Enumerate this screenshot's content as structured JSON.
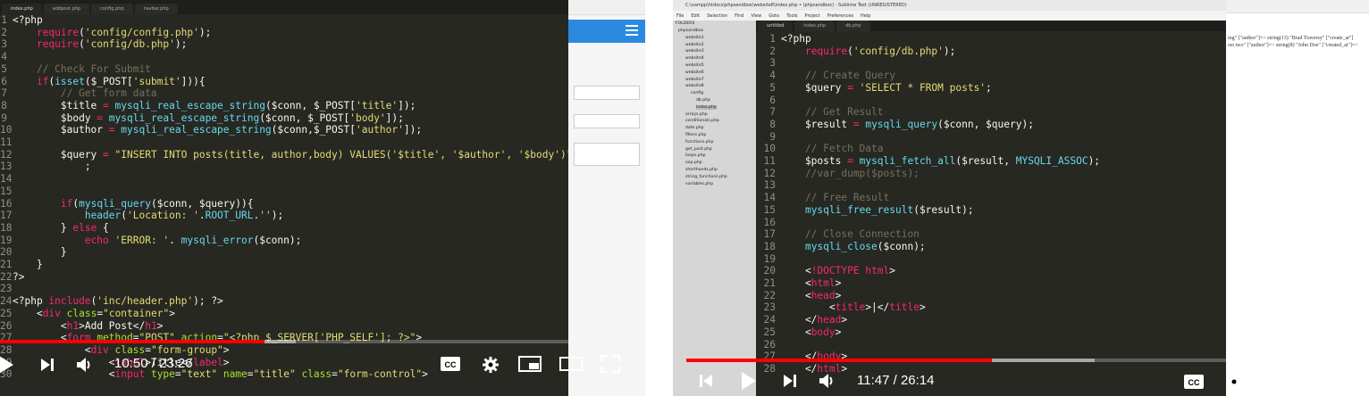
{
  "left_player": {
    "tabs": [
      "index.php",
      "addpost.php",
      "config.php",
      "navbar.php"
    ],
    "time_current": "10:50",
    "time_separator": " / ",
    "time_total": "23:26",
    "progress_fraction": 0.466,
    "buffered_fraction": 0.52,
    "line_numbers": [
      "1",
      "2",
      "3",
      "4",
      "5",
      "6",
      "7",
      "8",
      "9",
      "10",
      "11",
      "12",
      "13",
      "14",
      "15",
      "16",
      "17",
      "18",
      "19",
      "20",
      "21",
      "22",
      "23",
      "24",
      "25",
      "26",
      "27",
      "28",
      "29",
      "30"
    ],
    "code": [
      [
        {
          "c": "v",
          "t": "<?php"
        }
      ],
      [
        {
          "c": "v",
          "t": "    "
        },
        {
          "c": "k",
          "t": "require"
        },
        {
          "c": "v",
          "t": "("
        },
        {
          "c": "s",
          "t": "'config/config.php'"
        },
        {
          "c": "v",
          "t": ");"
        }
      ],
      [
        {
          "c": "v",
          "t": "    "
        },
        {
          "c": "k",
          "t": "require"
        },
        {
          "c": "v",
          "t": "("
        },
        {
          "c": "s",
          "t": "'config/db.php'"
        },
        {
          "c": "v",
          "t": ");"
        }
      ],
      [],
      [
        {
          "c": "c",
          "t": "    // Check For Submit"
        }
      ],
      [
        {
          "c": "v",
          "t": "    "
        },
        {
          "c": "k",
          "t": "if"
        },
        {
          "c": "v",
          "t": "("
        },
        {
          "c": "f",
          "t": "isset"
        },
        {
          "c": "v",
          "t": "($_POST["
        },
        {
          "c": "s",
          "t": "'submit'"
        },
        {
          "c": "v",
          "t": "])){"
        }
      ],
      [
        {
          "c": "c",
          "t": "        // Get form data"
        }
      ],
      [
        {
          "c": "v",
          "t": "        $title "
        },
        {
          "c": "k",
          "t": "="
        },
        {
          "c": "v",
          "t": " "
        },
        {
          "c": "f",
          "t": "mysqli_real_escape_string"
        },
        {
          "c": "v",
          "t": "($conn, $_POST["
        },
        {
          "c": "s",
          "t": "'title'"
        },
        {
          "c": "v",
          "t": "]);"
        }
      ],
      [
        {
          "c": "v",
          "t": "        $body "
        },
        {
          "c": "k",
          "t": "="
        },
        {
          "c": "v",
          "t": " "
        },
        {
          "c": "f",
          "t": "mysqli_real_escape_string"
        },
        {
          "c": "v",
          "t": "($conn, $_POST["
        },
        {
          "c": "s",
          "t": "'body'"
        },
        {
          "c": "v",
          "t": "]);"
        }
      ],
      [
        {
          "c": "v",
          "t": "        $author "
        },
        {
          "c": "k",
          "t": "="
        },
        {
          "c": "v",
          "t": " "
        },
        {
          "c": "f",
          "t": "mysqli_real_escape_string"
        },
        {
          "c": "v",
          "t": "($conn,$_POST["
        },
        {
          "c": "s",
          "t": "'author'"
        },
        {
          "c": "v",
          "t": "]);"
        }
      ],
      [],
      [
        {
          "c": "v",
          "t": "        $query "
        },
        {
          "c": "k",
          "t": "="
        },
        {
          "c": "v",
          "t": " "
        },
        {
          "c": "s",
          "t": "\"INSERT INTO posts(title, author,body) VALUES('$title', '$author', '$body')\""
        }
      ],
      [
        {
          "c": "v",
          "t": "            ;"
        }
      ],
      [],
      [],
      [
        {
          "c": "v",
          "t": "        "
        },
        {
          "c": "k",
          "t": "if"
        },
        {
          "c": "v",
          "t": "("
        },
        {
          "c": "f",
          "t": "mysqli_query"
        },
        {
          "c": "v",
          "t": "($conn, $query)){"
        }
      ],
      [
        {
          "c": "v",
          "t": "            "
        },
        {
          "c": "f",
          "t": "header"
        },
        {
          "c": "v",
          "t": "("
        },
        {
          "c": "s",
          "t": "'Location: '"
        },
        {
          "c": "v",
          "t": "."
        },
        {
          "c": "f",
          "t": "ROOT_URL"
        },
        {
          "c": "v",
          "t": "."
        },
        {
          "c": "s",
          "t": "''"
        },
        {
          "c": "v",
          "t": ");"
        }
      ],
      [
        {
          "c": "v",
          "t": "        } "
        },
        {
          "c": "k",
          "t": "else"
        },
        {
          "c": "v",
          "t": " {"
        }
      ],
      [
        {
          "c": "v",
          "t": "            "
        },
        {
          "c": "k",
          "t": "echo"
        },
        {
          "c": "v",
          "t": " "
        },
        {
          "c": "s",
          "t": "'ERROR: '"
        },
        {
          "c": "v",
          "t": ". "
        },
        {
          "c": "f",
          "t": "mysqli_error"
        },
        {
          "c": "v",
          "t": "($conn);"
        }
      ],
      [
        {
          "c": "v",
          "t": "        }"
        }
      ],
      [
        {
          "c": "v",
          "t": "    }"
        }
      ],
      [
        {
          "c": "v",
          "t": "?>"
        }
      ],
      [],
      [
        {
          "c": "v",
          "t": "<?php "
        },
        {
          "c": "k",
          "t": "include"
        },
        {
          "c": "v",
          "t": "("
        },
        {
          "c": "s",
          "t": "'inc/header.php'"
        },
        {
          "c": "v",
          "t": "); ?>"
        }
      ],
      [
        {
          "c": "v",
          "t": "    <"
        },
        {
          "c": "t",
          "t": "div"
        },
        {
          "c": "v",
          "t": " "
        },
        {
          "c": "a",
          "t": "class"
        },
        {
          "c": "v",
          "t": "="
        },
        {
          "c": "s",
          "t": "\"container\""
        },
        {
          "c": "v",
          "t": ">"
        }
      ],
      [
        {
          "c": "v",
          "t": "        <"
        },
        {
          "c": "t",
          "t": "h1"
        },
        {
          "c": "v",
          "t": ">Add Post</"
        },
        {
          "c": "t",
          "t": "h1"
        },
        {
          "c": "v",
          "t": ">"
        }
      ],
      [
        {
          "c": "v",
          "t": "        <"
        },
        {
          "c": "t",
          "t": "form"
        },
        {
          "c": "v",
          "t": " "
        },
        {
          "c": "a",
          "t": "method"
        },
        {
          "c": "v",
          "t": "="
        },
        {
          "c": "s",
          "t": "\"POST\""
        },
        {
          "c": "v",
          "t": " "
        },
        {
          "c": "a",
          "t": "action"
        },
        {
          "c": "v",
          "t": "="
        },
        {
          "c": "s",
          "t": "\"<?php $_SERVER['PHP_SELF']; ?>\""
        },
        {
          "c": "v",
          "t": ">"
        }
      ],
      [
        {
          "c": "v",
          "t": "            <"
        },
        {
          "c": "t",
          "t": "div"
        },
        {
          "c": "v",
          "t": " "
        },
        {
          "c": "a",
          "t": "class"
        },
        {
          "c": "v",
          "t": "="
        },
        {
          "c": "s",
          "t": "\"form-group\""
        },
        {
          "c": "v",
          "t": ">"
        }
      ],
      [
        {
          "c": "v",
          "t": "                <"
        },
        {
          "c": "t",
          "t": "label"
        },
        {
          "c": "v",
          "t": ">Title</"
        },
        {
          "c": "t",
          "t": "label"
        },
        {
          "c": "v",
          "t": ">"
        }
      ],
      [
        {
          "c": "v",
          "t": "                <"
        },
        {
          "c": "t",
          "t": "input"
        },
        {
          "c": "v",
          "t": " "
        },
        {
          "c": "a",
          "t": "type"
        },
        {
          "c": "v",
          "t": "="
        },
        {
          "c": "s",
          "t": "\"text\""
        },
        {
          "c": "v",
          "t": " "
        },
        {
          "c": "a",
          "t": "name"
        },
        {
          "c": "v",
          "t": "="
        },
        {
          "c": "s",
          "t": "\"title\""
        },
        {
          "c": "v",
          "t": " "
        },
        {
          "c": "a",
          "t": "class"
        },
        {
          "c": "v",
          "t": "="
        },
        {
          "c": "s",
          "t": "\"form-control\""
        },
        {
          "c": "v",
          "t": ">"
        }
      ]
    ]
  },
  "right_player": {
    "window_title": "C:\\xampp\\htdocs\\phpsandbox\\website8\\index.php • (phpsandbox) - Sublime Text (UNREGISTERED)",
    "menu": [
      "File",
      "Edit",
      "Selection",
      "Find",
      "View",
      "Goto",
      "Tools",
      "Project",
      "Preferences",
      "Help"
    ],
    "sidebar_label": "FOLDERS",
    "sidebar": [
      "phpsandbox",
      "website1",
      "website2",
      "website3",
      "website4",
      "website5",
      "website6",
      "website7",
      "website8",
      "config",
      "db.php",
      "index.php",
      "arrays.php",
      "conditionals.php",
      "date.php",
      "filters.php",
      "functions.php",
      "get_post.php",
      "loops.php",
      "oop.php",
      "shorthands.php",
      "string_functions.php",
      "variables.php"
    ],
    "tabs": [
      "untitled",
      "index.php",
      "db.php"
    ],
    "time_current": "11:47",
    "time_separator": " / ",
    "time_total": "26:14",
    "progress_fraction": 0.45,
    "buffered_fraction": 0.6,
    "web_text": [
      "ing\" [\"author\"]=> string(13) \"Brad Traversy\" [\"create_at\"]",
      "ost two\" [\"author\"]=> string(8) \"John Doe\" [\"created_at\"]=>"
    ],
    "line_numbers": [
      "1",
      "2",
      "3",
      "4",
      "5",
      "6",
      "7",
      "8",
      "9",
      "10",
      "11",
      "12",
      "13",
      "14",
      "15",
      "16",
      "17",
      "18",
      "19",
      "20",
      "21",
      "22",
      "23",
      "24",
      "25",
      "26",
      "27",
      "28"
    ],
    "code": [
      [
        {
          "c": "v",
          "t": "<?php"
        }
      ],
      [
        {
          "c": "v",
          "t": "    "
        },
        {
          "c": "k",
          "t": "require"
        },
        {
          "c": "v",
          "t": "("
        },
        {
          "c": "s",
          "t": "'config/db.php'"
        },
        {
          "c": "v",
          "t": ");"
        }
      ],
      [],
      [
        {
          "c": "c",
          "t": "    // Create Query"
        }
      ],
      [
        {
          "c": "v",
          "t": "    $query "
        },
        {
          "c": "k",
          "t": "="
        },
        {
          "c": "v",
          "t": " "
        },
        {
          "c": "s",
          "t": "'SELECT * FROM posts'"
        },
        {
          "c": "v",
          "t": ";"
        }
      ],
      [],
      [
        {
          "c": "c",
          "t": "    // Get Result"
        }
      ],
      [
        {
          "c": "v",
          "t": "    $result "
        },
        {
          "c": "k",
          "t": "="
        },
        {
          "c": "v",
          "t": " "
        },
        {
          "c": "f",
          "t": "mysqli_query"
        },
        {
          "c": "v",
          "t": "($conn, $query);"
        }
      ],
      [],
      [
        {
          "c": "c",
          "t": "    // Fetch Data"
        }
      ],
      [
        {
          "c": "v",
          "t": "    $posts "
        },
        {
          "c": "k",
          "t": "="
        },
        {
          "c": "v",
          "t": " "
        },
        {
          "c": "f",
          "t": "mysqli_fetch_all"
        },
        {
          "c": "v",
          "t": "($result, "
        },
        {
          "c": "f",
          "t": "MYSQLI_ASSOC"
        },
        {
          "c": "v",
          "t": ");"
        }
      ],
      [
        {
          "c": "c",
          "t": "    //var_dump($posts);"
        }
      ],
      [],
      [
        {
          "c": "c",
          "t": "    // Free Result"
        }
      ],
      [
        {
          "c": "v",
          "t": "    "
        },
        {
          "c": "f",
          "t": "mysqli_free_result"
        },
        {
          "c": "v",
          "t": "($result);"
        }
      ],
      [],
      [
        {
          "c": "c",
          "t": "    // Close Connection"
        }
      ],
      [
        {
          "c": "v",
          "t": "    "
        },
        {
          "c": "f",
          "t": "mysqli_close"
        },
        {
          "c": "v",
          "t": "($conn);"
        }
      ],
      [],
      [
        {
          "c": "v",
          "t": "    <"
        },
        {
          "c": "k",
          "t": "!DOCTYPE"
        },
        {
          "c": "v",
          "t": " "
        },
        {
          "c": "t",
          "t": "html"
        },
        {
          "c": "v",
          "t": ">"
        }
      ],
      [
        {
          "c": "v",
          "t": "    <"
        },
        {
          "c": "t",
          "t": "html"
        },
        {
          "c": "v",
          "t": ">"
        }
      ],
      [
        {
          "c": "v",
          "t": "    <"
        },
        {
          "c": "t",
          "t": "head"
        },
        {
          "c": "v",
          "t": ">"
        }
      ],
      [
        {
          "c": "v",
          "t": "        <"
        },
        {
          "c": "t",
          "t": "title"
        },
        {
          "c": "v",
          "t": ">|</"
        },
        {
          "c": "t",
          "t": "title"
        },
        {
          "c": "v",
          "t": ">"
        }
      ],
      [
        {
          "c": "v",
          "t": "    </"
        },
        {
          "c": "t",
          "t": "head"
        },
        {
          "c": "v",
          "t": ">"
        }
      ],
      [
        {
          "c": "v",
          "t": "    <"
        },
        {
          "c": "t",
          "t": "body"
        },
        {
          "c": "v",
          "t": ">"
        }
      ],
      [],
      [
        {
          "c": "v",
          "t": "    </"
        },
        {
          "c": "t",
          "t": "body"
        },
        {
          "c": "v",
          "t": ">"
        }
      ],
      [
        {
          "c": "v",
          "t": "    </"
        },
        {
          "c": "t",
          "t": "html"
        },
        {
          "c": "v",
          "t": ">"
        }
      ]
    ]
  },
  "colors": {
    "editor_bg": "#272822",
    "progress": "#ff0000",
    "keyword": "#f92672",
    "string": "#e6db74",
    "function": "#66d9ef",
    "comment": "#75715e"
  },
  "icons": [
    "play-icon",
    "next-icon",
    "volume-icon",
    "captions-icon",
    "settings-icon",
    "miniplayer-icon",
    "theater-icon",
    "fullscreen-icon",
    "previous-icon",
    "hamburger-icon"
  ],
  "captions_label": "CC"
}
